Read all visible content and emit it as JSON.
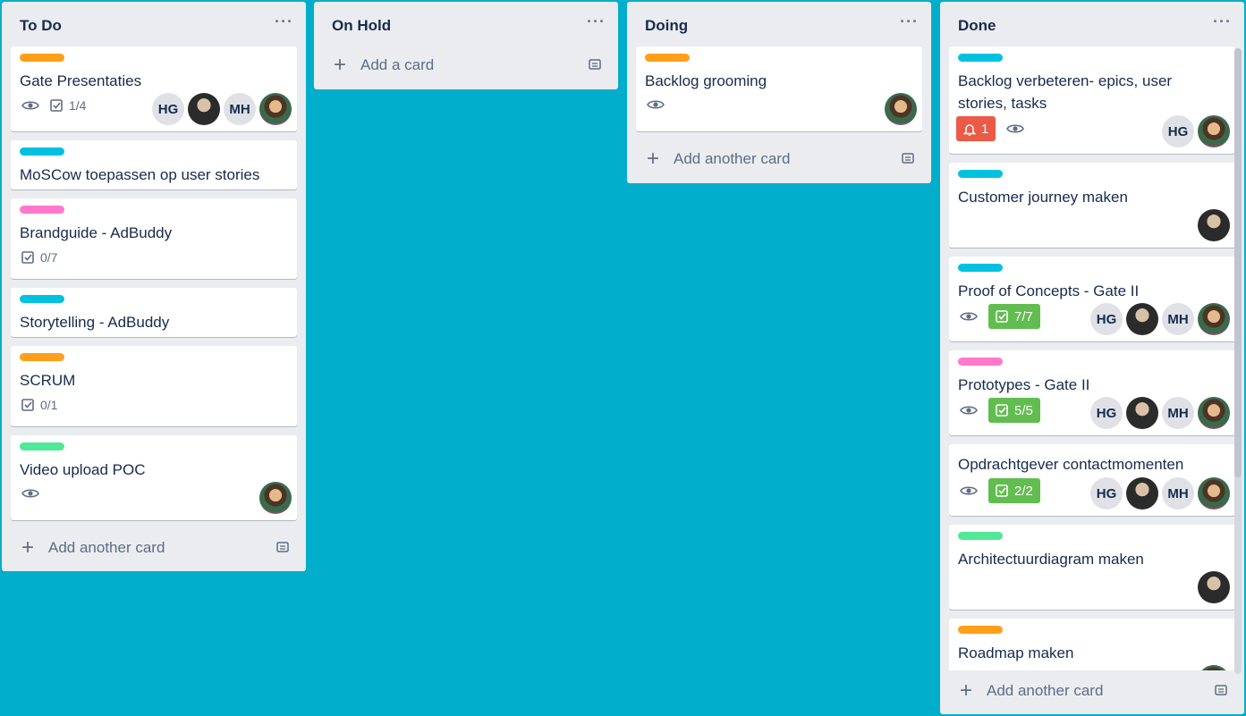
{
  "colors": {
    "board_bg": "#00aecc",
    "label_orange": "#ff9f1a",
    "label_sky": "#00c2e0",
    "label_pink": "#ff78cb",
    "label_lime": "#51e898",
    "badge_green": "#61bd4f",
    "badge_red": "#eb5a46"
  },
  "lists": [
    {
      "title": "To Do",
      "menu": "···",
      "add_label": "Add another card",
      "cards": [
        {
          "title": "Gate Presentaties",
          "label_color": "orange",
          "checklist": "1/4",
          "members": [
            "HG",
            "photo",
            "MH",
            "photo2"
          ]
        },
        {
          "title": "MoSCow toepassen op user stories",
          "label_color": "sky"
        },
        {
          "title": "Brandguide - AdBuddy",
          "label_color": "pink",
          "checklist": "0/7"
        },
        {
          "title": "Storytelling - AdBuddy",
          "label_color": "sky"
        },
        {
          "title": "SCRUM",
          "label_color": "orange",
          "checklist": "0/1"
        },
        {
          "title": "Video upload POC",
          "label_color": "lime",
          "members": [
            "photo2"
          ]
        }
      ]
    },
    {
      "title": "On Hold",
      "menu": "···",
      "add_label": "Add a card",
      "cards": []
    },
    {
      "title": "Doing",
      "menu": "···",
      "add_label": "Add another card",
      "cards": [
        {
          "title": "Backlog grooming",
          "label_color": "orange",
          "members": [
            "photo2"
          ]
        }
      ]
    },
    {
      "title": "Done",
      "menu": "···",
      "add_label": "Add another card",
      "cards": [
        {
          "title": "Backlog verbeteren- epics, user stories, tasks",
          "label_color": "sky",
          "notification": "1",
          "members": [
            "HG",
            "photo2"
          ]
        },
        {
          "title": "Customer journey maken",
          "label_color": "sky",
          "members": [
            "photo"
          ]
        },
        {
          "title": "Proof of Concepts - Gate II",
          "label_color": "sky",
          "checklist": "7/7",
          "members": [
            "HG",
            "photo",
            "MH",
            "photo2"
          ]
        },
        {
          "title": "Prototypes - Gate II",
          "label_color": "pink",
          "checklist": "5/5",
          "members": [
            "HG",
            "photo",
            "MH",
            "photo2"
          ]
        },
        {
          "title": "Opdrachtgever contactmomenten",
          "label_color": "sky",
          "checklist": "2/2",
          "members": [
            "HG",
            "photo",
            "MH",
            "photo2"
          ]
        },
        {
          "title": "Architectuurdiagram maken",
          "label_color": "lime",
          "members": [
            "photo"
          ]
        },
        {
          "title": "Roadmap maken",
          "label_color": "orange"
        }
      ]
    }
  ],
  "avatar_initials": {
    "hg": "HG",
    "mh": "MH"
  }
}
